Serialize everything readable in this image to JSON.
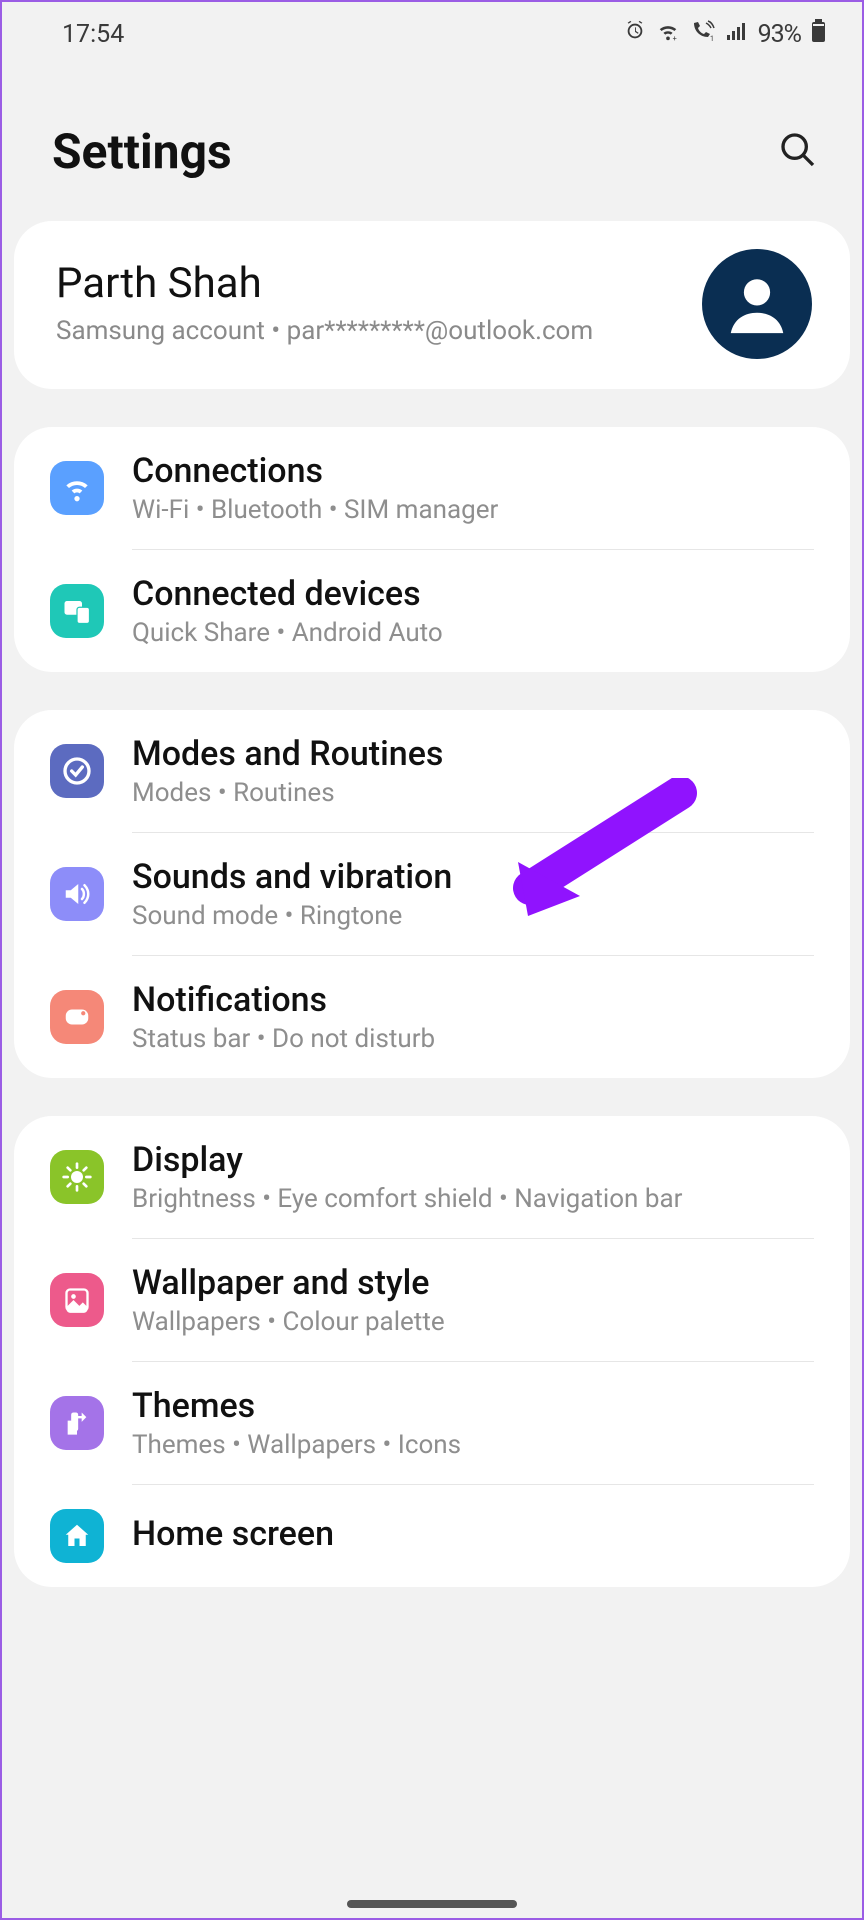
{
  "status": {
    "time": "17:54",
    "battery": "93%"
  },
  "header": {
    "title": "Settings"
  },
  "account": {
    "name": "Parth Shah",
    "subtitle": "Samsung account  •  par*********@outlook.com"
  },
  "groups": [
    {
      "items": [
        {
          "icon": "wifi",
          "bg": "bg-blue",
          "title": "Connections",
          "subtitle": "Wi-Fi  •  Bluetooth  •  SIM manager"
        },
        {
          "icon": "devices",
          "bg": "bg-teal",
          "title": "Connected devices",
          "subtitle": "Quick Share  •  Android Auto"
        }
      ]
    },
    {
      "items": [
        {
          "icon": "routines",
          "bg": "bg-indigo",
          "title": "Modes and Routines",
          "subtitle": "Modes  •  Routines"
        },
        {
          "icon": "sound",
          "bg": "bg-violet",
          "title": "Sounds and vibration",
          "subtitle": "Sound mode  •  Ringtone"
        },
        {
          "icon": "notif",
          "bg": "bg-salmon",
          "title": "Notifications",
          "subtitle": "Status bar  •  Do not disturb"
        }
      ]
    },
    {
      "items": [
        {
          "icon": "display",
          "bg": "bg-green",
          "title": "Display",
          "subtitle": "Brightness  •  Eye comfort shield  •  Navigation bar"
        },
        {
          "icon": "wallpaper",
          "bg": "bg-pink",
          "title": "Wallpaper and style",
          "subtitle": "Wallpapers  •  Colour palette"
        },
        {
          "icon": "themes",
          "bg": "bg-purple",
          "title": "Themes",
          "subtitle": "Themes  •  Wallpapers  •  Icons"
        },
        {
          "icon": "home",
          "bg": "bg-cyan",
          "title": "Home screen",
          "subtitle": ""
        }
      ]
    }
  ]
}
